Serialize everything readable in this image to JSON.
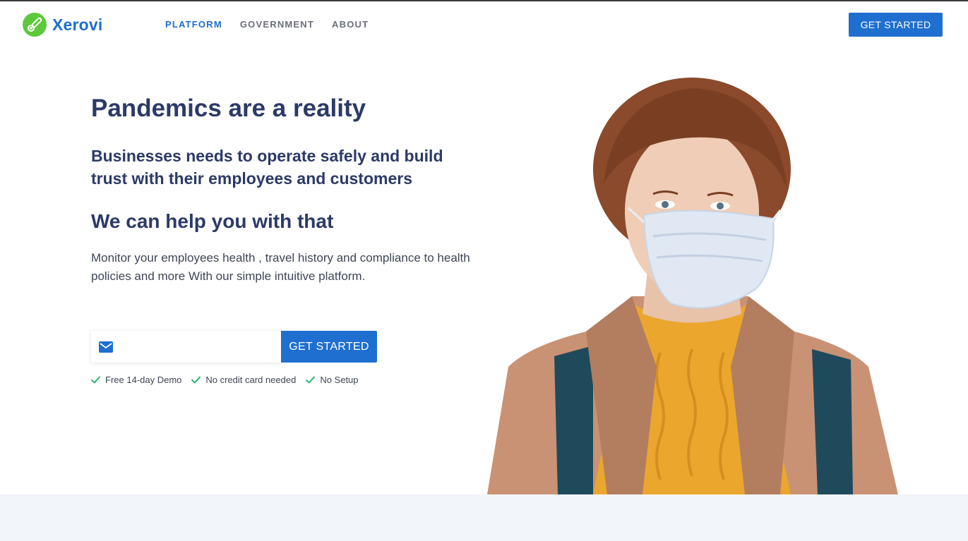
{
  "brand": {
    "name": "Xerovi",
    "logo_icon": "thermometer-icon",
    "accent_color": "#1e6fcf",
    "logo_color": "#5cc93b"
  },
  "nav": {
    "items": [
      {
        "label": "PLATFORM",
        "active": true
      },
      {
        "label": "GOVERNMENT",
        "active": false
      },
      {
        "label": "ABOUT",
        "active": false
      }
    ],
    "cta_label": "GET STARTED"
  },
  "hero": {
    "title": "Pandemics are a reality",
    "subtitle": "Businesses needs to operate safely and build trust with their employees and customers",
    "help_heading": "We can help you with that",
    "description": "Monitor your employees health , travel history and compliance to health policies and more With our simple intuitive platform.",
    "form": {
      "email_icon": "mail-icon",
      "email_value": "",
      "email_placeholder": "",
      "cta_label": "GET STARTED"
    },
    "perks": [
      {
        "icon": "check-icon",
        "label": "Free 14-day Demo"
      },
      {
        "icon": "check-icon",
        "label": "No credit card needed"
      },
      {
        "icon": "check-icon",
        "label": "No Setup"
      }
    ],
    "photo": "woman-wearing-face-mask"
  }
}
